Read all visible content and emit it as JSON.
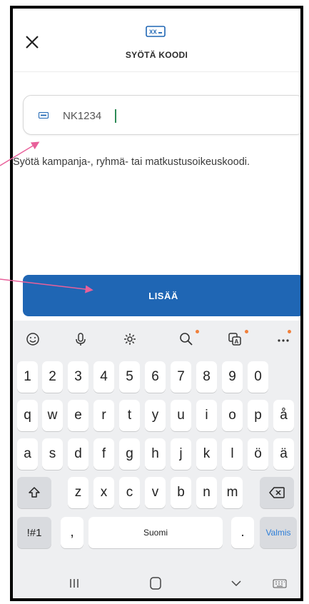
{
  "header": {
    "icon": "code-ticket-icon",
    "title": "SYÖTÄ KOODI",
    "close_icon": "close-icon"
  },
  "code_field": {
    "icon": "ticket-icon",
    "value": "NK1234"
  },
  "helper_text": "Syötä kampanja-, ryhmä- tai matkustusoikeuskoodi.",
  "add_button": {
    "label": "LISÄÄ"
  },
  "keyboard": {
    "toolbar_icons": [
      "emoji-icon",
      "microphone-icon",
      "settings-icon",
      "search-icon",
      "translate-icon",
      "more-icon"
    ],
    "row_numbers": [
      "1",
      "2",
      "3",
      "4",
      "5",
      "6",
      "7",
      "8",
      "9",
      "0"
    ],
    "row_1": [
      "q",
      "w",
      "e",
      "r",
      "t",
      "y",
      "u",
      "i",
      "o",
      "p",
      "å"
    ],
    "row_2": [
      "a",
      "s",
      "d",
      "f",
      "g",
      "h",
      "j",
      "k",
      "l",
      "ö",
      "ä"
    ],
    "row_3": [
      "z",
      "x",
      "c",
      "v",
      "b",
      "n",
      "m"
    ],
    "symbols_label": "!#1",
    "comma_label": ",",
    "space_label": "Suomi",
    "period_label": ".",
    "done_label": "Valmis"
  },
  "nav_icons": [
    "recent-apps-icon",
    "home-icon",
    "back-icon",
    "keyboard-icon"
  ],
  "colors": {
    "accent": "#1f66b4",
    "annotation_arrow": "#e8609a",
    "done_text": "#2f7fd8"
  }
}
